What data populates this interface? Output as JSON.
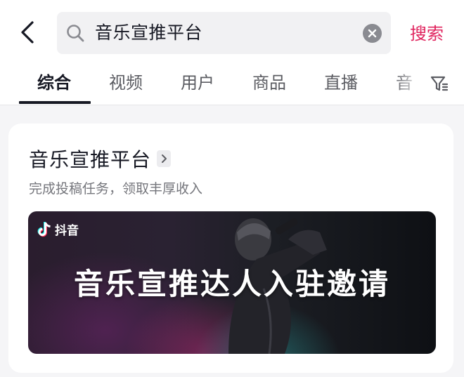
{
  "header": {
    "back_icon": "chevron-left-icon",
    "search": {
      "query": "音乐宣推平台",
      "icon": "search-icon",
      "clear_icon": "clear-icon"
    },
    "search_button_label": "搜索"
  },
  "tabs": {
    "items": [
      {
        "label": "综合",
        "active": true
      },
      {
        "label": "视频",
        "active": false
      },
      {
        "label": "用户",
        "active": false
      },
      {
        "label": "商品",
        "active": false
      },
      {
        "label": "直播",
        "active": false
      },
      {
        "label": "音",
        "active": false
      }
    ],
    "filter_icon": "filter-icon"
  },
  "result_card": {
    "title": "音乐宣推平台",
    "subtitle": "完成投稿任务，领取丰厚收入",
    "banner": {
      "brand_text": "抖音",
      "headline": "音乐宣推达人入驻邀请"
    }
  },
  "colors": {
    "accent": "#e0245e",
    "text_primary": "#161823",
    "text_secondary": "#75767c",
    "background": "#f5f5f7"
  }
}
